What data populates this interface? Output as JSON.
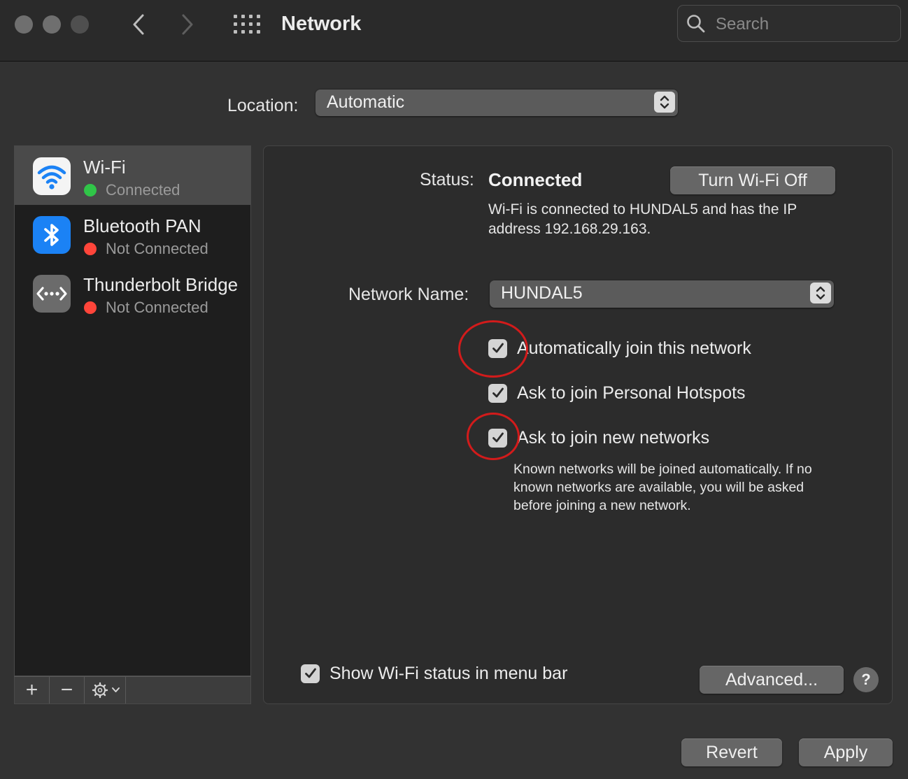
{
  "window": {
    "title": "Network"
  },
  "search": {
    "placeholder": "Search"
  },
  "location": {
    "label": "Location:",
    "value": "Automatic"
  },
  "sidebar": {
    "services": [
      {
        "name": "Wi-Fi",
        "status": "Connected",
        "status_color": "#30c548",
        "icon": "wifi-icon",
        "selected": true
      },
      {
        "name": "Bluetooth PAN",
        "status": "Not Connected",
        "status_color": "#ff453a",
        "icon": "bluetooth-icon",
        "selected": false
      },
      {
        "name": "Thunderbolt Bridge",
        "status": "Not Connected",
        "status_color": "#ff453a",
        "icon": "thunderbolt-bridge-icon",
        "selected": false
      }
    ],
    "toolbar": {
      "add_label": "+",
      "remove_label": "−",
      "action_icon": "gear-icon"
    }
  },
  "detail": {
    "status_label": "Status:",
    "status_value": "Connected",
    "turn_off_label": "Turn Wi-Fi Off",
    "status_description": "Wi-Fi is connected to HUNDAL5 and has the IP address 192.168.29.163.",
    "network_name_label": "Network Name:",
    "network_name_value": "HUNDAL5",
    "options": [
      {
        "label": "Automatically join this network",
        "checked": true
      },
      {
        "label": "Ask to join Personal Hotspots",
        "checked": true
      },
      {
        "label": "Ask to join new networks",
        "checked": true
      }
    ],
    "help_text": "Known networks will be joined automatically. If no known networks are available, you will be asked before joining a new network.",
    "show_menubar_label": "Show Wi-Fi status in menu bar",
    "show_menubar_checked": true,
    "advanced_label": "Advanced...",
    "help_label": "?"
  },
  "footer": {
    "revert_label": "Revert",
    "apply_label": "Apply"
  },
  "colors": {
    "accent_blue": "#1b82f5",
    "annotation_red": "#d21b1b"
  }
}
